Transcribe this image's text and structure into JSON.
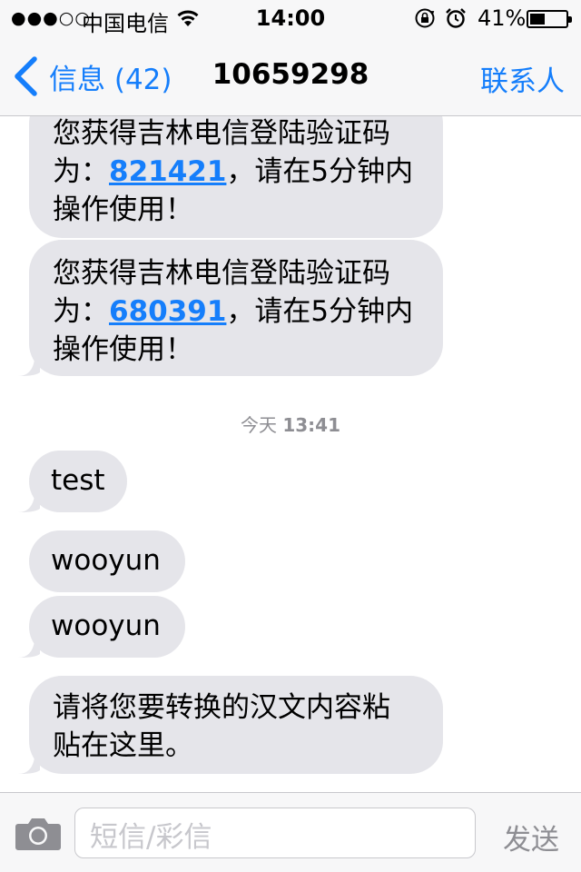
{
  "status_bar": {
    "signal": "●●●○○",
    "carrier": "中国电信",
    "time": "14:00",
    "battery_percent": "41%",
    "battery_level": 0.41,
    "icons": [
      "wifi-icon",
      "orientation-lock-icon",
      "alarm-icon",
      "battery-icon"
    ]
  },
  "nav": {
    "back_label": "信息 (42)",
    "title": "10659298",
    "contact_label": "联系人"
  },
  "messages": [
    {
      "prefix": "您获得吉林电信登陆验证码为：",
      "code": "821421",
      "suffix": "，请在5分钟内操作使用！"
    },
    {
      "prefix": "您获得吉林电信登陆验证码为：",
      "code": "680391",
      "suffix": "，请在5分钟内操作使用！"
    },
    {
      "text": "test"
    },
    {
      "text": "wooyun"
    },
    {
      "text": "wooyun"
    },
    {
      "text": "请将您要转换的汉文内容粘贴在这里。"
    }
  ],
  "msg_lines": {
    "m1_line1": "您获得吉林电信登陆验证码",
    "m1_line2_pre": "为：",
    "m1_code": "821421",
    "m1_line2_post": "，请在5分钟内",
    "m1_line3": "操作使用！",
    "m2_line1": "您获得吉林电信登陆验证码",
    "m2_line2_pre": "为：",
    "m2_code": "680391",
    "m2_line2_post": "，请在5分钟内",
    "m2_line3": "操作使用！",
    "m6_line1": "请将您要转换的汉文内容粘",
    "m6_line2": "贴在这里。"
  },
  "timestamp": {
    "day": "今天",
    "time": "13:41"
  },
  "composer": {
    "placeholder": "短信/彩信",
    "send_label": "发送"
  },
  "colors": {
    "accent": "#157efb",
    "incoming_bubble": "#e5e5ea",
    "bar_background": "#f7f7f8",
    "muted_text": "#8e8e93"
  }
}
